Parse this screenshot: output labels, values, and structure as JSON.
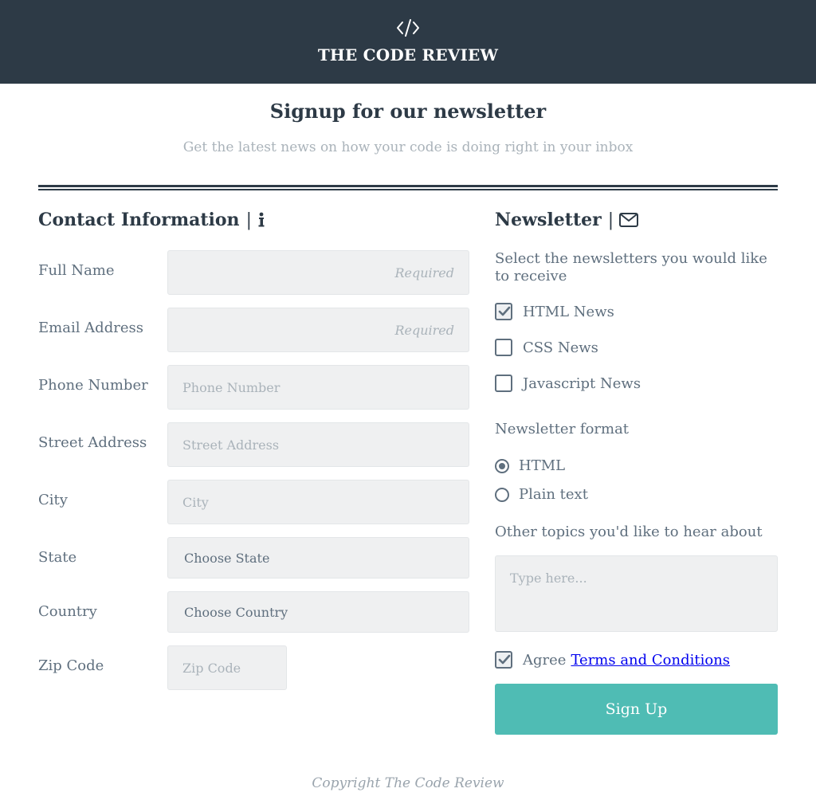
{
  "header": {
    "logo_icon": "code-icon",
    "title": "THE CODE REVIEW",
    "background": "#2d3a46"
  },
  "intro": {
    "headline": "Signup for our newsletter",
    "subline": "Get the latest news on how your code is doing right in your inbox"
  },
  "contact": {
    "title": "Contact Information",
    "separator": "|",
    "title_icon": "info-icon",
    "fields": {
      "full_name": {
        "label": "Full Name",
        "placeholder": "Required"
      },
      "email": {
        "label": "Email Address",
        "placeholder": "Required"
      },
      "phone": {
        "label": "Phone Number",
        "placeholder": "Phone Number"
      },
      "street": {
        "label": "Street Address",
        "placeholder": "Street Address"
      },
      "city": {
        "label": "City",
        "placeholder": "City"
      },
      "state": {
        "label": "State",
        "value": "Choose State"
      },
      "country": {
        "label": "Country",
        "value": "Choose Country"
      },
      "zip": {
        "label": "Zip Code",
        "placeholder": "Zip Code"
      }
    }
  },
  "newsletter": {
    "title": "Newsletter",
    "separator": "|",
    "title_icon": "envelope-icon",
    "description": "Select the newsletters you would like to receive",
    "options": [
      {
        "label": "HTML News",
        "checked": true
      },
      {
        "label": "CSS News",
        "checked": false
      },
      {
        "label": "Javascript News",
        "checked": false
      }
    ],
    "format_label": "Newsletter format",
    "formats": [
      {
        "label": "HTML",
        "selected": true
      },
      {
        "label": "Plain text",
        "selected": false
      }
    ],
    "topics_label": "Other topics you'd like to hear about",
    "topics_placeholder": "Type here...",
    "agree_label": "Agree",
    "agree_checked": true,
    "terms_link": "Terms and Conditions",
    "submit_label": "Sign Up",
    "accent": "#4fbcb4"
  },
  "footer": {
    "copyright": "Copyright The Code Review"
  }
}
